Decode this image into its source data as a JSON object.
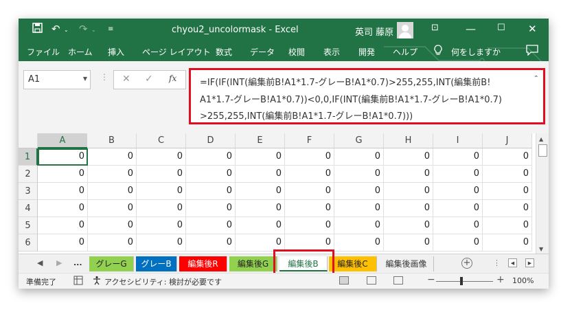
{
  "window": {
    "title": "chyou2_uncolormask  -  Excel",
    "user_name": "英司 藤原",
    "colors": {
      "brand": "#217346",
      "highlight": "#e00f1f"
    }
  },
  "quick_access": {
    "save_icon": "save-icon",
    "undo_icon": "undo-icon",
    "redo_icon": "redo-icon",
    "customize_icon": "customize-icon"
  },
  "window_controls": {
    "ribbon_display_icon": "ribbon-display-icon",
    "minimize_icon": "minimize-icon",
    "maximize_icon": "maximize-icon",
    "close_icon": "close-icon"
  },
  "ribbon": {
    "tabs": [
      {
        "key": "file",
        "label": "ファイル"
      },
      {
        "key": "home",
        "label": "ホーム"
      },
      {
        "key": "insert",
        "label": "挿入"
      },
      {
        "key": "layout",
        "label": "ページ レイアウト"
      },
      {
        "key": "formulas",
        "label": "数式"
      },
      {
        "key": "data",
        "label": "データ"
      },
      {
        "key": "review",
        "label": "校閲"
      },
      {
        "key": "view",
        "label": "表示"
      },
      {
        "key": "developer",
        "label": "開発"
      },
      {
        "key": "help",
        "label": "ヘルプ"
      }
    ],
    "tell_me": "何をしますか",
    "comment_icon": "comment-icon"
  },
  "formula_bar": {
    "name_box": "A1",
    "cancel": "✕",
    "confirm": "✓",
    "fx": "fx",
    "formula_lines": [
      "=IF(IF(INT(編集前B!A1*1.7-グレーB!A1*0.7)>255,255,INT(編集前B!",
      "A1*1.7-グレーB!A1*0.7))<0,0,IF(INT(編集前B!A1*1.7-グレーB!A1*0.7)",
      ">255,255,INT(編集前B!A1*1.7-グレーB!A1*0.7)))"
    ]
  },
  "grid": {
    "columns": [
      "A",
      "B",
      "C",
      "D",
      "E",
      "F",
      "G",
      "H",
      "I",
      "J"
    ],
    "rows": [
      {
        "label": "1",
        "values": [
          "0",
          "0",
          "0",
          "0",
          "0",
          "0",
          "0",
          "0",
          "0",
          "0"
        ]
      },
      {
        "label": "2",
        "values": [
          "0",
          "0",
          "0",
          "0",
          "0",
          "0",
          "0",
          "0",
          "0",
          "0"
        ]
      },
      {
        "label": "3",
        "values": [
          "0",
          "0",
          "0",
          "0",
          "0",
          "0",
          "0",
          "0",
          "0",
          "0"
        ]
      },
      {
        "label": "4",
        "values": [
          "0",
          "0",
          "0",
          "0",
          "0",
          "0",
          "0",
          "0",
          "0",
          "0"
        ]
      },
      {
        "label": "5",
        "values": [
          "0",
          "0",
          "0",
          "0",
          "0",
          "0",
          "0",
          "0",
          "0",
          "0"
        ]
      },
      {
        "label": "6",
        "values": [
          "0",
          "0",
          "0",
          "0",
          "0",
          "0",
          "0",
          "0",
          "0",
          "0"
        ]
      }
    ],
    "active_cell": "A1"
  },
  "sheets": {
    "more": "...",
    "tabs": [
      {
        "label": "グレーG",
        "bg": "#92d050",
        "fg": "#222222",
        "active": false
      },
      {
        "label": "グレーB",
        "bg": "#0070c0",
        "fg": "#ffffff",
        "active": false
      },
      {
        "label": "編集後R",
        "bg": "#ff0000",
        "fg": "#ffffff",
        "active": false
      },
      {
        "label": "編集後G",
        "bg": "#92d050",
        "fg": "#222222",
        "active": false
      },
      {
        "label": "編集後B",
        "bg": "#ffffff",
        "fg": "#217346",
        "active": true
      },
      {
        "label": "編集後C",
        "bg": "#ffc000",
        "fg": "#222222",
        "active": false
      },
      {
        "label": "編集後画像",
        "bg": "#f0f0f0",
        "fg": "#333333",
        "active": false
      }
    ],
    "add_symbol": "+"
  },
  "status": {
    "ready": "準備完了",
    "accessibility": "アクセシビリティ: 検討が必要です",
    "zoom": "100%",
    "zoom_level_percent": 100
  }
}
